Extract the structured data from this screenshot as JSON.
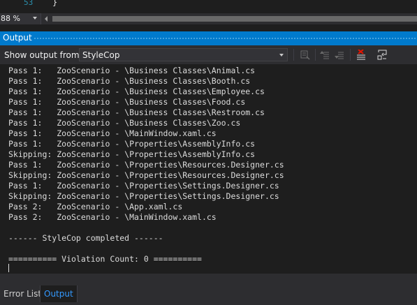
{
  "editor": {
    "line_number": "53",
    "code": "}"
  },
  "zoom": {
    "value": "88 %"
  },
  "panel": {
    "title": "Output"
  },
  "toolbar": {
    "show_label": "Show output from:",
    "source_selected": "StyleCop",
    "icons": [
      "find-message-in-code-icon",
      "go-to-previous-message-icon",
      "go-to-next-message-icon",
      "clear-all-icon",
      "toggle-word-wrap-icon"
    ]
  },
  "output": {
    "lines": [
      "Pass 1:   ZooScenario - \\Business Classes\\Animal.cs",
      "Pass 1:   ZooScenario - \\Business Classes\\Booth.cs",
      "Pass 1:   ZooScenario - \\Business Classes\\Employee.cs",
      "Pass 1:   ZooScenario - \\Business Classes\\Food.cs",
      "Pass 1:   ZooScenario - \\Business Classes\\Restroom.cs",
      "Pass 1:   ZooScenario - \\Business Classes\\Zoo.cs",
      "Pass 1:   ZooScenario - \\MainWindow.xaml.cs",
      "Pass 1:   ZooScenario - \\Properties\\AssemblyInfo.cs",
      "Skipping: ZooScenario - \\Properties\\AssemblyInfo.cs",
      "Pass 1:   ZooScenario - \\Properties\\Resources.Designer.cs",
      "Skipping: ZooScenario - \\Properties\\Resources.Designer.cs",
      "Pass 1:   ZooScenario - \\Properties\\Settings.Designer.cs",
      "Skipping: ZooScenario - \\Properties\\Settings.Designer.cs",
      "Pass 2:   ZooScenario - \\App.xaml.cs",
      "Pass 2:   ZooScenario - \\MainWindow.xaml.cs",
      "",
      "------ StyleCop completed ------",
      "",
      "========== Violation Count: 0 =========="
    ]
  },
  "tabs": {
    "error_list": "Error List",
    "output": "Output"
  },
  "colors": {
    "accent": "#007acc",
    "background": "#1e1e1e",
    "chrome": "#2d2d30",
    "active_tab_text": "#3399ff",
    "line_number": "#2b91af"
  }
}
